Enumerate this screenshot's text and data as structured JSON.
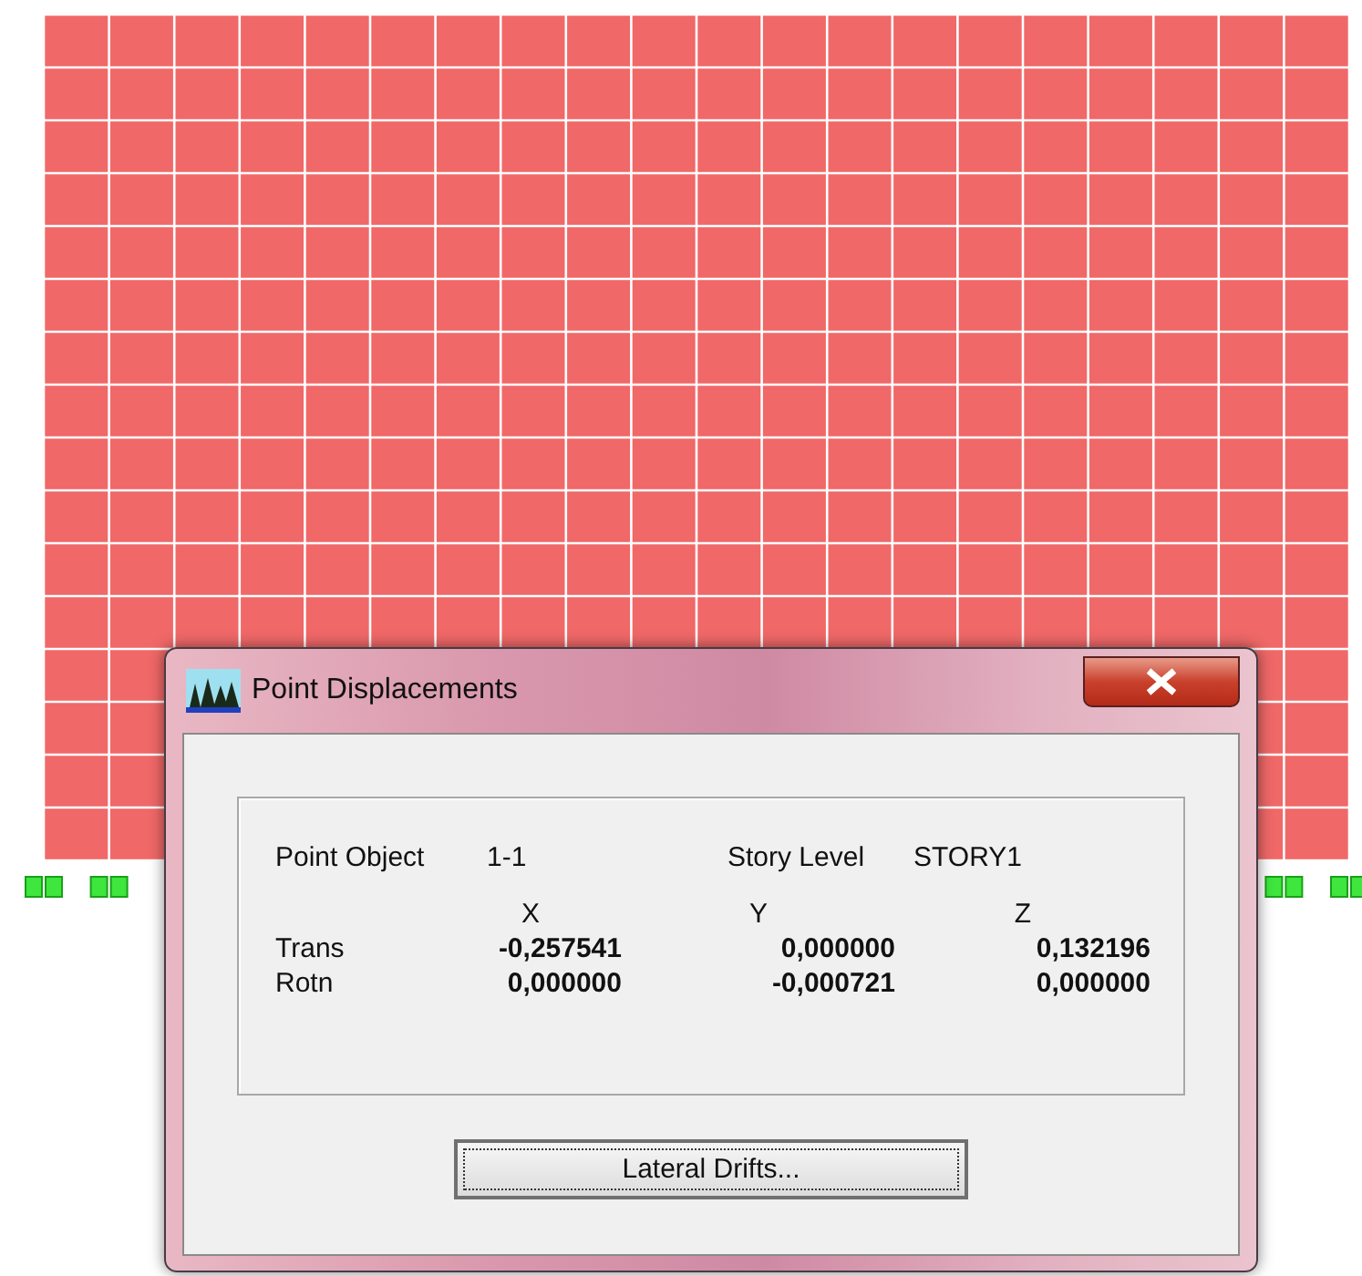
{
  "dialog": {
    "title": "Point Displacements",
    "point_object": {
      "label": "Point Object",
      "value": "1-1"
    },
    "story_level": {
      "label": "Story Level",
      "value": "STORY1"
    },
    "columns": [
      "X",
      "Y",
      "Z"
    ],
    "rows": [
      {
        "label": "Trans",
        "values": [
          "-0,257541",
          "0,000000",
          "0,132196"
        ]
      },
      {
        "label": "Rotn",
        "values": [
          "0,000000",
          "-0,000721",
          "0,000000"
        ]
      }
    ],
    "button": "Lateral Drifts..."
  }
}
